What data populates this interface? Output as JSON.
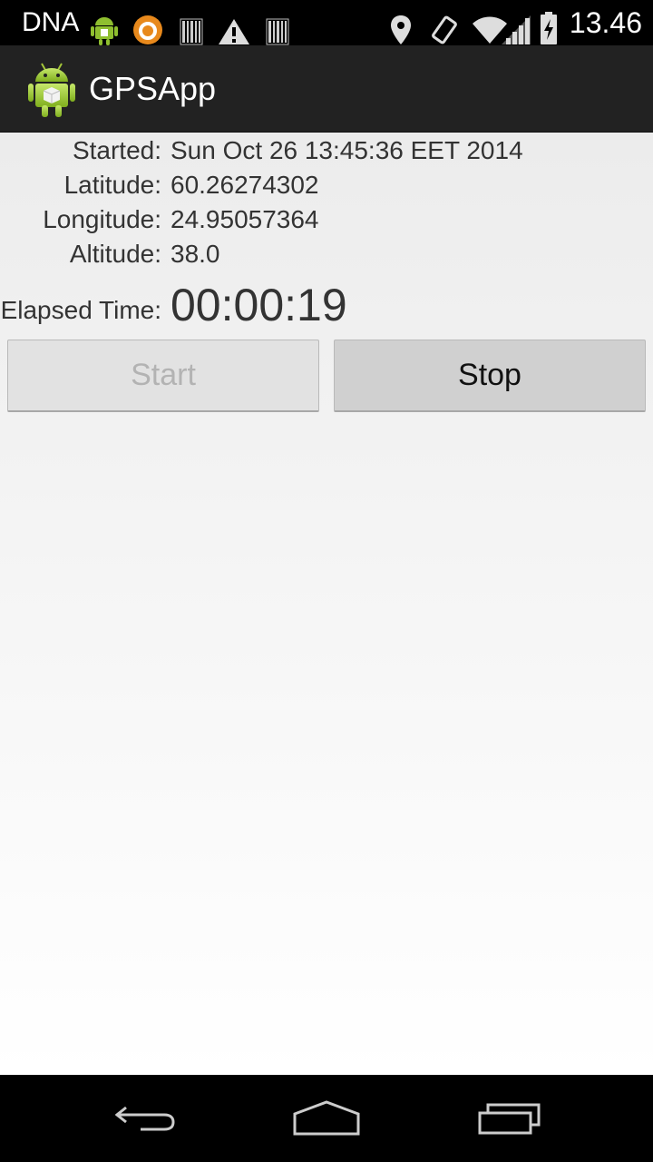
{
  "status_bar": {
    "carrier": "DNA",
    "time": "13.46",
    "icons": [
      "android-icon",
      "orange-circle-icon",
      "barcode-icon",
      "warning-icon",
      "barcode-icon",
      "location-icon",
      "vibrate-icon",
      "wifi-icon",
      "signal-icon",
      "battery-charging-icon"
    ]
  },
  "action_bar": {
    "title": "GPSApp",
    "icon": "android-app-icon"
  },
  "info": {
    "started_label": "Started:",
    "started_value": "Sun Oct 26 13:45:36 EET 2014",
    "latitude_label": "Latitude:",
    "latitude_value": "60.26274302",
    "longitude_label": "Longitude:",
    "longitude_value": "24.95057364",
    "altitude_label": "Altitude:",
    "altitude_value": "38.0",
    "elapsed_label": "Elapsed Time:",
    "elapsed_value": "00:00:19"
  },
  "buttons": {
    "start_label": "Start",
    "start_enabled": false,
    "stop_label": "Stop",
    "stop_enabled": true
  },
  "nav_bar": {
    "icons": [
      "back-icon",
      "home-icon",
      "recents-icon"
    ]
  },
  "colors": {
    "action_bar": "#222222",
    "android_green": "#a4c639",
    "text": "#333333"
  }
}
